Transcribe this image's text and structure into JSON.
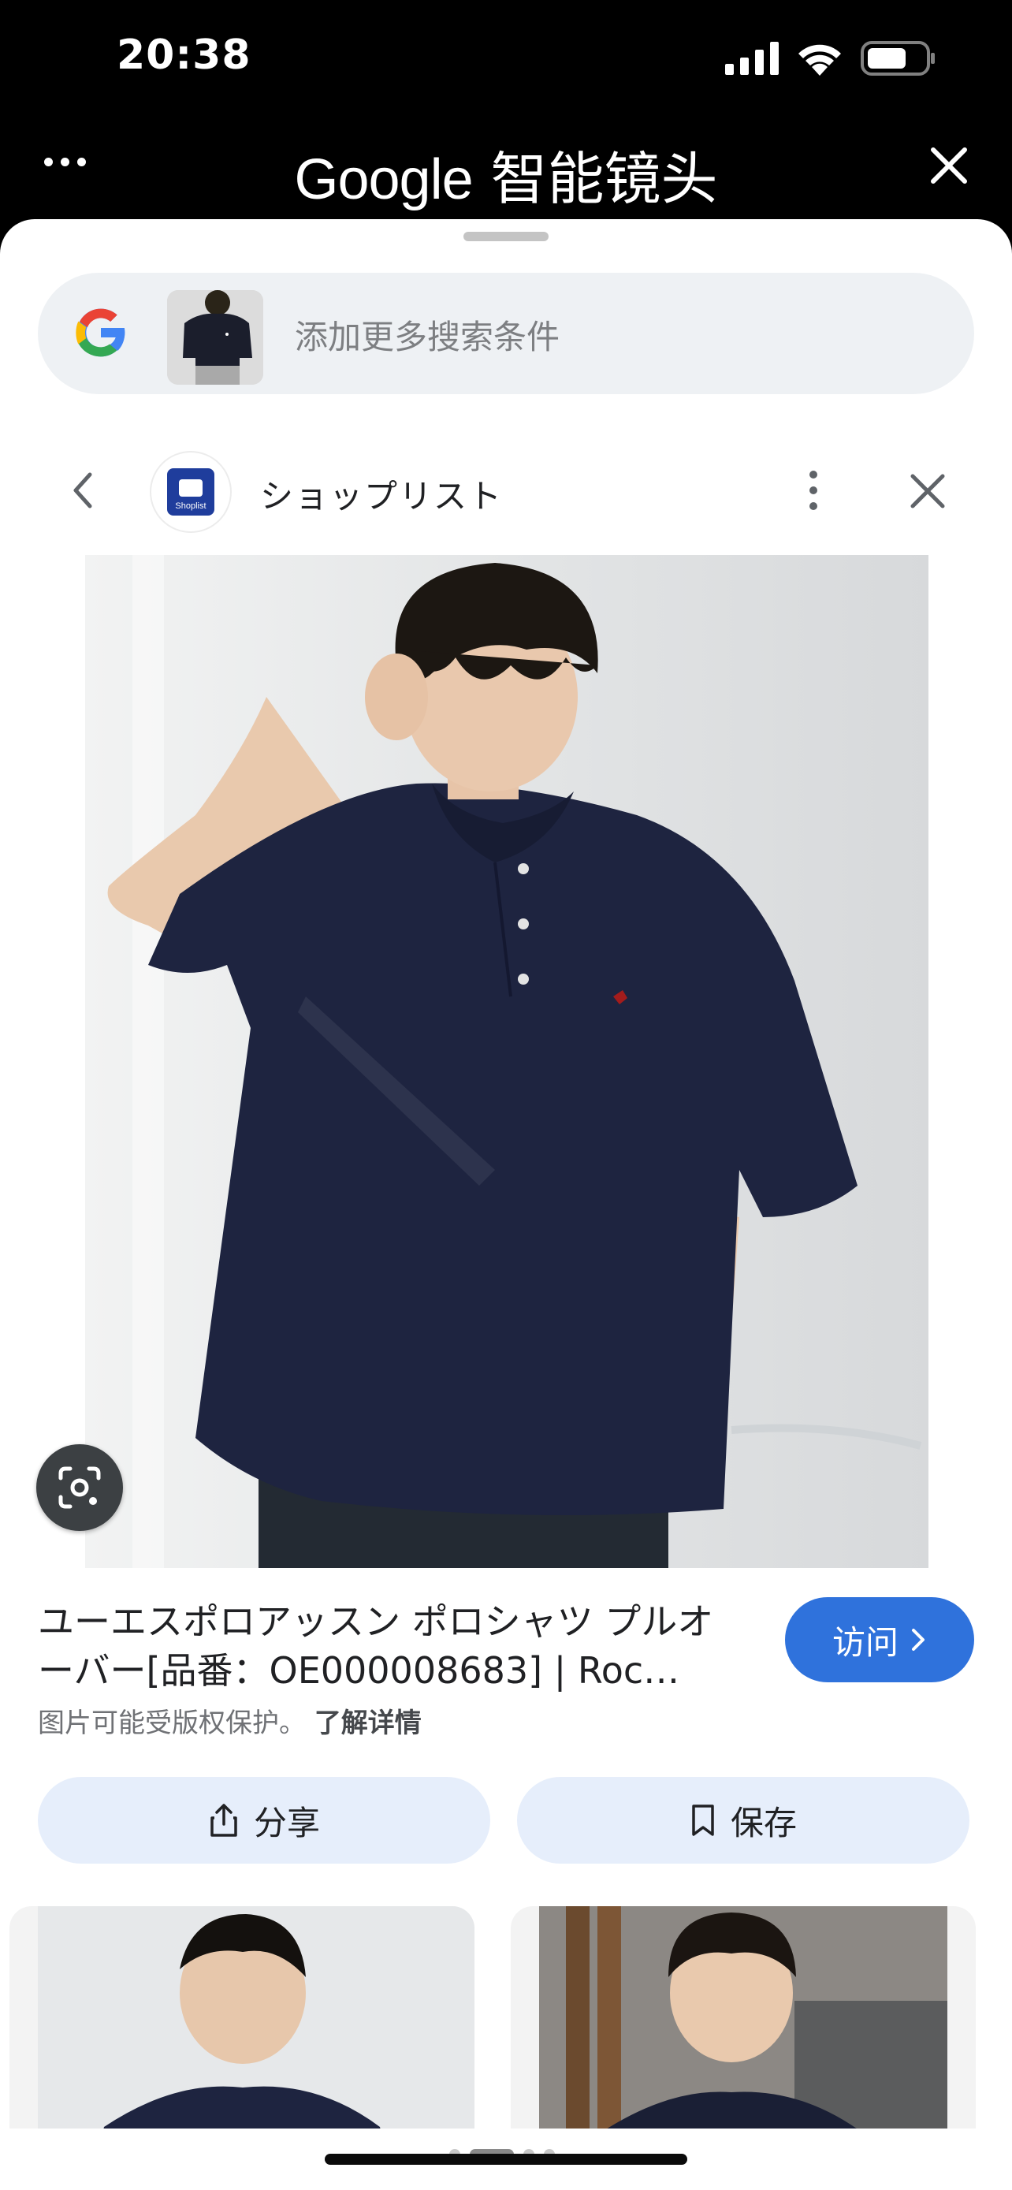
{
  "status_bar": {
    "time": "20:38",
    "icons": [
      "cellular-signal-icon",
      "wifi-icon",
      "battery-icon"
    ]
  },
  "header": {
    "title_brand": "Google",
    "title_text": "智能镜头",
    "more_icon": "more-horizontal-icon",
    "close_icon": "close-icon"
  },
  "search": {
    "placeholder": "添加更多搜索条件"
  },
  "source": {
    "site_name": "ショップリスト",
    "logo_text": "Shoplist"
  },
  "product": {
    "title": "ユーエスポロアッスン ポロシャツ プルオーバー[品番：OE000008683] | Roc…",
    "visit_label": "访问",
    "copyright_text": "图片可能受版权保护。",
    "learn_more": "了解详情"
  },
  "actions": {
    "share_label": "分享",
    "save_label": "保存"
  },
  "colors": {
    "accent_blue": "#2f72dc",
    "action_button_bg": "#e6eefb",
    "search_bg": "#eef1f4",
    "shirt_navy": "#1e2440"
  }
}
